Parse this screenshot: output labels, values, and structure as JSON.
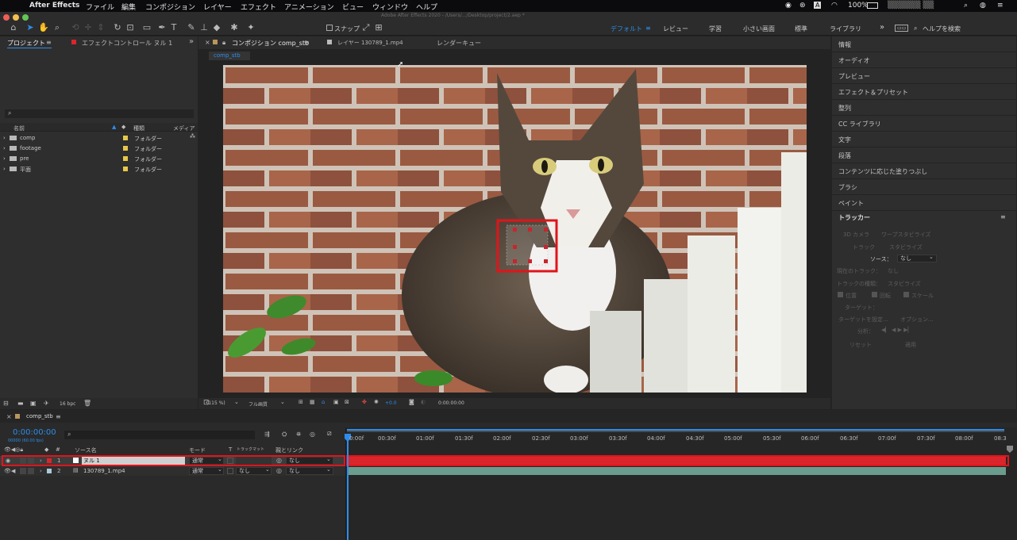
{
  "menubar": {
    "app_name": "After Effects",
    "items": [
      "ファイル",
      "編集",
      "コンポジション",
      "レイヤー",
      "エフェクト",
      "アニメーション",
      "ビュー",
      "ウィンドウ",
      "ヘルプ"
    ],
    "battery": "100%",
    "window_title": "Adobe After Effects 2020 - /Users/.../Desktop/project/2.aep *"
  },
  "toolbar": {
    "snap_label": "スナップ",
    "workspaces": [
      "デフォルト",
      "レビュー",
      "学習",
      "小さい画面",
      "標準",
      "ライブラリ"
    ],
    "help_search_placeholder": "ヘルプを検索"
  },
  "project_panel": {
    "tab_project": "プロジェクト",
    "tab_effect_controls": "エフェクトコントロール ヌル 1",
    "search_placeholder": "",
    "col_name": "名前",
    "col_type": "種類",
    "col_media": "メディア",
    "items": [
      {
        "name": "comp",
        "type": "フォルダー"
      },
      {
        "name": "footage",
        "type": "フォルダー"
      },
      {
        "name": "pre",
        "type": "フォルダー"
      },
      {
        "name": "平面",
        "type": "フォルダー"
      }
    ],
    "bpc": "16 bpc"
  },
  "comp_panel": {
    "tab_composition": "コンポジション comp_stb",
    "tab_layer": "レイヤー 130789_1.mp4",
    "tab_render": "レンダーキュー",
    "comp_chip": "comp_stb",
    "zoom": "(115 %)",
    "resolution": "フル画質",
    "exposure": "+0.0",
    "timecode": "0:00:00:00"
  },
  "right_panel": {
    "items": [
      "情報",
      "オーディオ",
      "プレビュー",
      "エフェクト＆プリセット",
      "整列",
      "CC ライブラリ",
      "文字",
      "段落",
      "コンテンツに応じた塗りつぶし",
      "ブラシ",
      "ペイント"
    ],
    "tracker": {
      "title": "トラッカー",
      "camera_3d": "3D カメラ",
      "warp_stabilize": "ワープスタビライズ",
      "track": "トラック",
      "stabilize": "スタビライズ",
      "source_label": "ソース：",
      "source_value": "なし",
      "current_track_label": "現在のトラック：",
      "current_track_value": "なし",
      "track_type_label": "トラックの種類：",
      "track_type_value": "スタビライズ",
      "position": "位置",
      "rotation": "回転",
      "scale": "スケール",
      "target_label": "ターゲット：",
      "set_target": "ターゲットを設定...",
      "options": "オプション...",
      "analyze": "分析：",
      "reset": "リセット",
      "apply": "適用"
    }
  },
  "timeline": {
    "comp_tab": "comp_stb",
    "timecode": "0:00:00:00",
    "frame_info": "00000 (60.00 fps)",
    "cols": {
      "source": "ソース名",
      "mode": "モード",
      "t": "T",
      "trkmat": "トラックマット",
      "parent": "親とリンク"
    },
    "ruler": [
      "0:00f",
      "00:30f",
      "01:00f",
      "01:30f",
      "02:00f",
      "02:30f",
      "03:00f",
      "03:30f",
      "04:00f",
      "04:30f",
      "05:00f",
      "05:30f",
      "06:00f",
      "06:30f",
      "07:00f",
      "07:30f",
      "08:00f",
      "08:3"
    ],
    "layers": [
      {
        "num": "1",
        "name": "ヌル 1",
        "mode": "通常",
        "trkmat": "",
        "parent": "なし"
      },
      {
        "num": "2",
        "name": "130789_1.mp4",
        "mode": "通常",
        "trkmat": "なし",
        "parent": "なし"
      }
    ]
  },
  "colors": {
    "accent": "#2d8ceb",
    "highlight": "#e0141b",
    "label_yellow": "#e6c84a",
    "track_teal": "#6b9d8e"
  }
}
